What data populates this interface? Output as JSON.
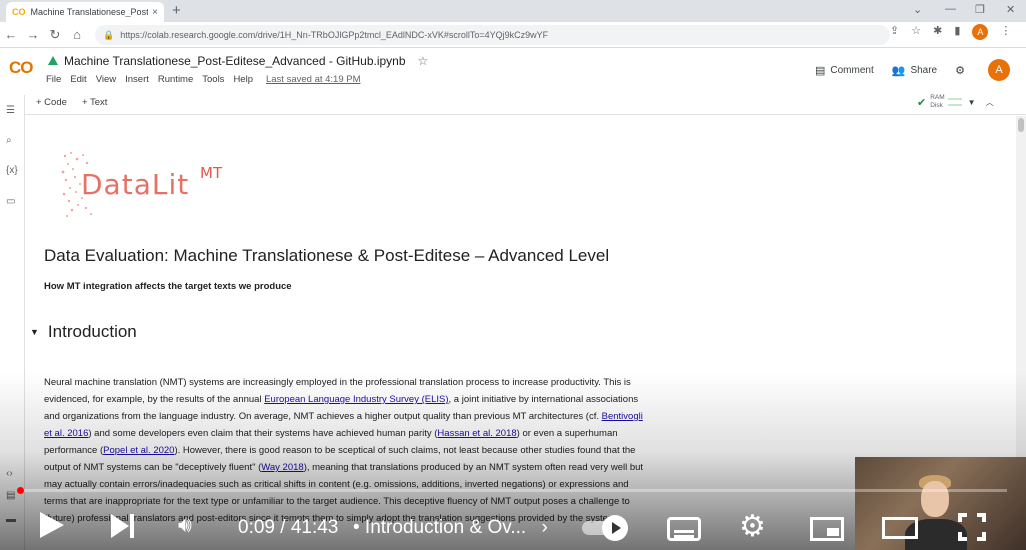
{
  "browser": {
    "tab_title": "Machine Translationese_Post-Edi",
    "tab_close": "×",
    "new_tab": "+",
    "url": "https://colab.research.google.com/drive/1H_Nn-TRbOJlGPp2tmcl_EAdlNDC-xVK#scrollTo=4YQj9kCz9wYF",
    "profile_initial": "A"
  },
  "colab": {
    "logo": "CO",
    "notebook_title": "Machine Translationese_Post-Editese_Advanced - GitHub.ipynb",
    "menu": [
      "File",
      "Edit",
      "View",
      "Insert",
      "Runtime",
      "Tools",
      "Help"
    ],
    "last_saved": "Last saved at 4:19 PM",
    "comment_label": "Comment",
    "share_label": "Share",
    "avatar_initial": "A",
    "add_code": "+ Code",
    "add_text": "+ Text",
    "ram_label": "RAM",
    "disk_label": "Disk"
  },
  "notebook": {
    "logo_text": "DataLit",
    "logo_superscript": "MT",
    "heading": "Data Evaluation: Machine Translationese & Post-Editese – Advanced Level",
    "subtitle": "How MT integration affects the target texts we produce",
    "section_title": "Introduction",
    "paragraph": {
      "l1": "Neural machine translation (NMT) systems are increasingly employed in the professional translation process to increase productivity. This is",
      "l2_a": "evidenced, for example, by the results of the annual ",
      "l2_link": "European Language Industry Survey (ELIS)",
      "l2_b": ", a joint initiative by international associations",
      "l3_a": "and organizations from the language industry. On average, NMT achieves a higher output quality than previous MT architectures (cf. ",
      "l3_link": "Bentivogli",
      "l4_link": "et al. 2016",
      "l4_a": ") and some developers even claim that their systems have achieved human parity (",
      "l4_link2": "Hassan et al. 2018",
      "l4_b": ") or even a superhuman",
      "l5_a": "performance (",
      "l5_link": "Popel et al. 2020",
      "l5_b": "). However, there is good reason to be sceptical of such claims, not least because other studies found that the",
      "l6_a": "output of NMT systems can be \"deceptively fluent\" (",
      "l6_link": "Way 2018",
      "l6_b": "), meaning that translations produced by an NMT system often read very well but",
      "l7": "may actually contain errors/inadequacies such as critical shifts in content (e.g. omissions, additions, inverted negations) or expressions and",
      "l8": "terms that are inappropriate for the text type or unfamiliar to the target audience. This deceptive fluency of NMT output poses a challenge to",
      "l9": "(future) professional translators and post-editors since it tempts them to simply adopt the translation suggestions provided by the system."
    }
  },
  "player": {
    "time": "0:09 / 41:43",
    "chapter": "•  Introduction & Ov...",
    "chapter_arrow": "›",
    "progress_fraction": 0.0036
  }
}
